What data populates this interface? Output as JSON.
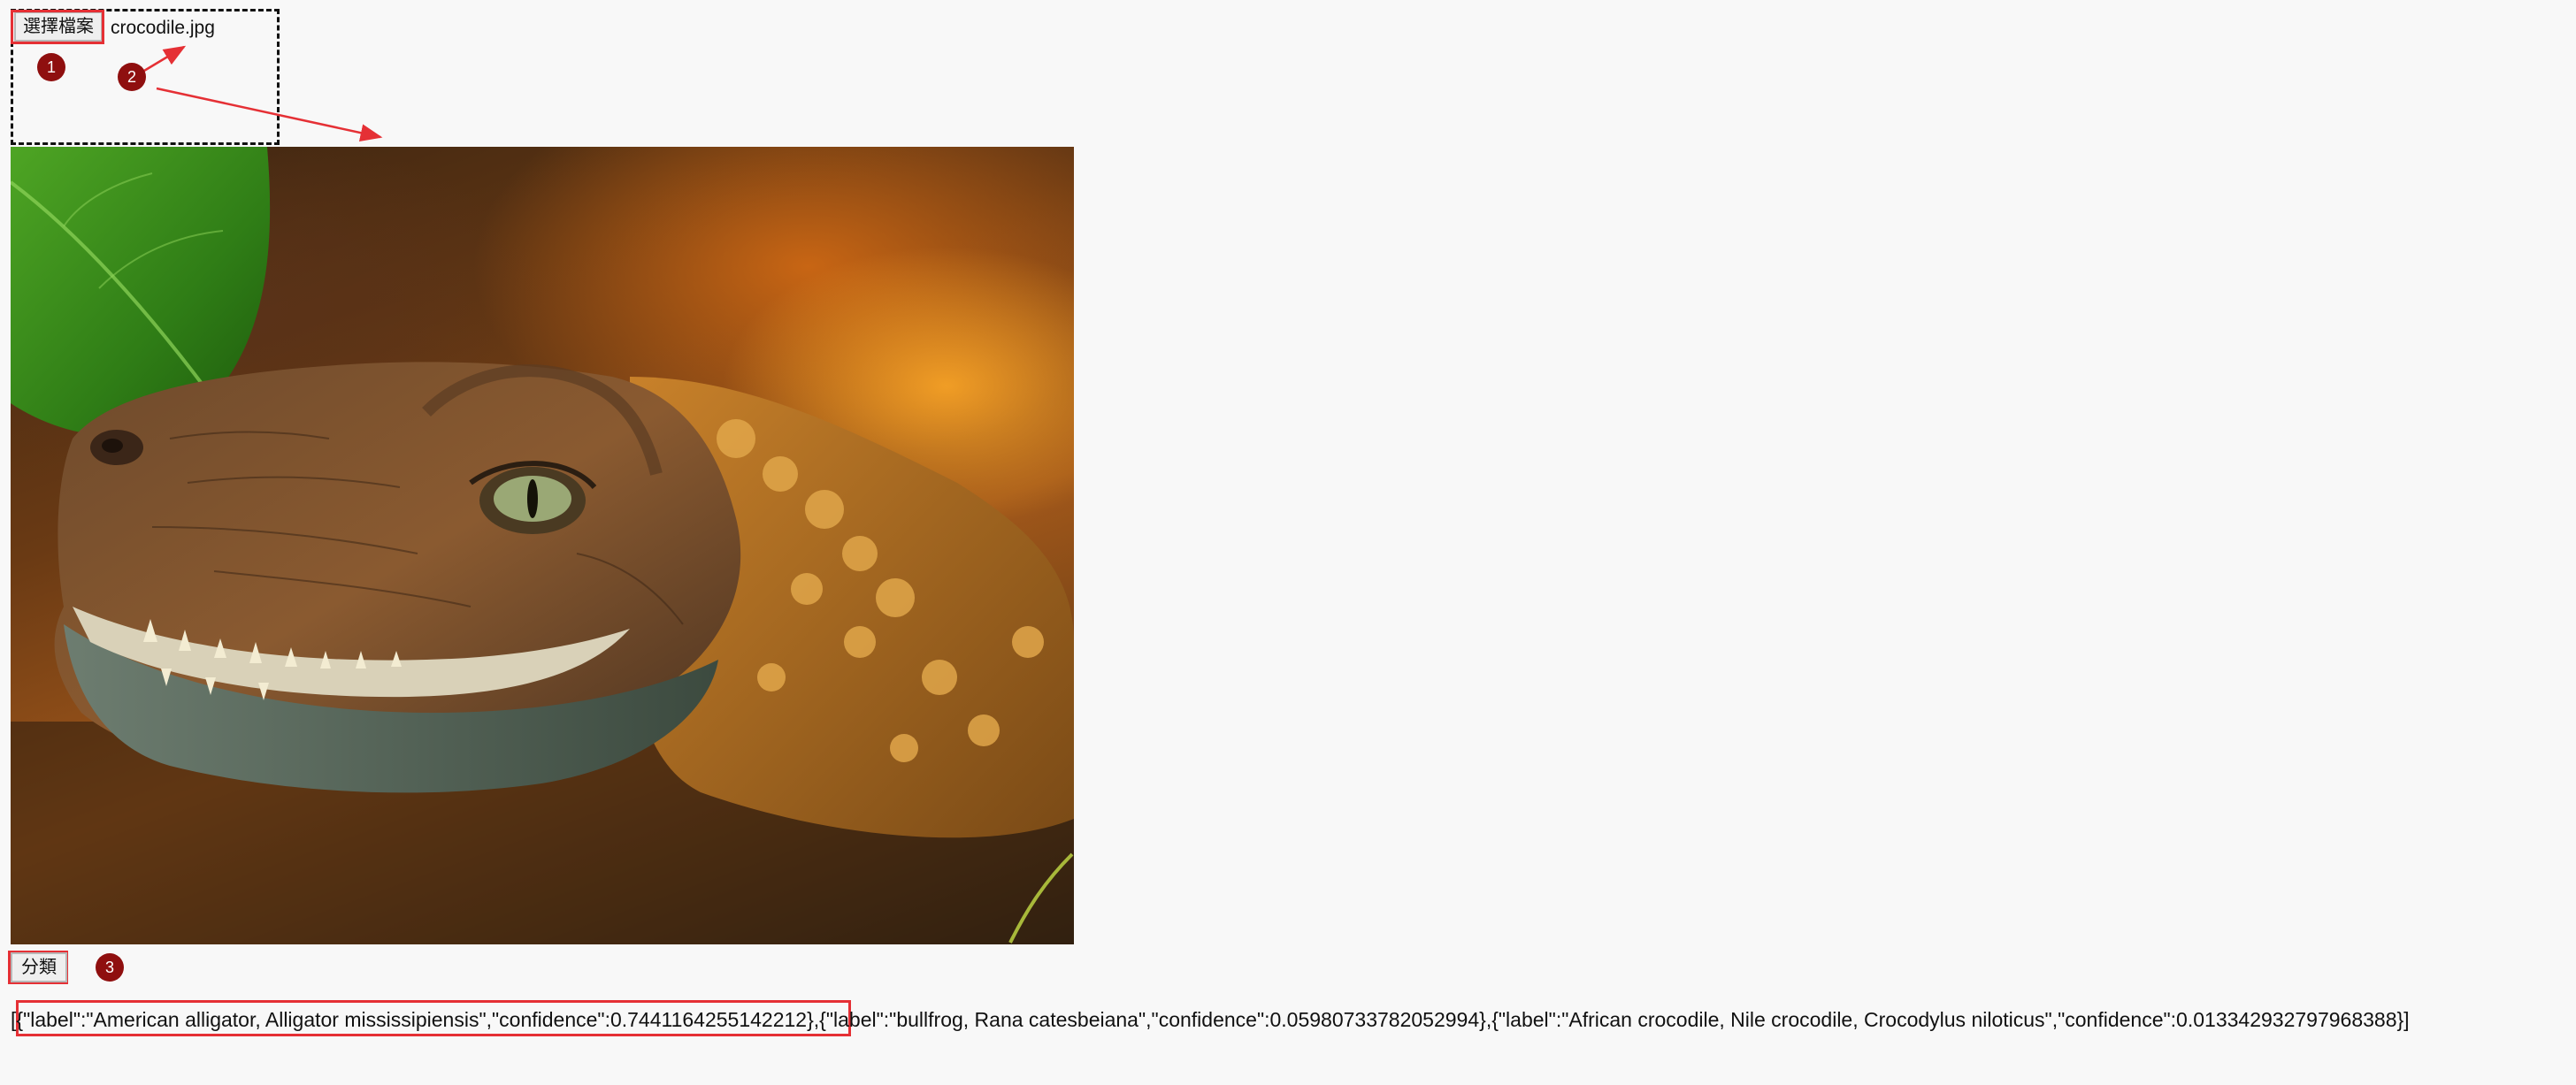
{
  "file_input": {
    "button_label": "選擇檔案",
    "file_name": "crocodile.jpg"
  },
  "image": {
    "icon": "crocodile-photo"
  },
  "classify_button": {
    "label": "分類"
  },
  "result": {
    "first": "{\"label\":\"American alligator, Alligator mississipiensis\",\"confidence\":0.7441164255142212}",
    "rest": ",{\"label\":\"bullfrog, Rana catesbeiana\",\"confidence\":0.05980733782052994},{\"label\":\"African crocodile, Nile crocodile, Crocodylus niloticus\",\"confidence\":0.013342932797968388}]",
    "open": "["
  },
  "annotations": {
    "markers": [
      "1",
      "2",
      "3"
    ],
    "color": "#e53035",
    "marker_color": "#8f0f0f"
  }
}
